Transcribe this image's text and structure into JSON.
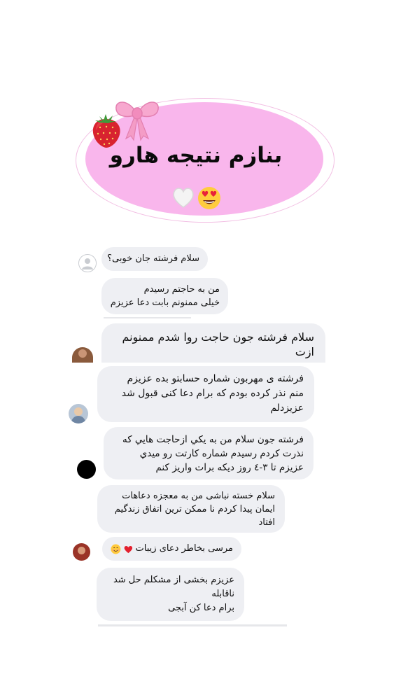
{
  "header": {
    "title": "بنازم نتیجه هارو"
  },
  "messages": [
    {
      "lines": [
        "سلام فرشته جان خوبی؟"
      ]
    },
    {
      "lines": [
        "من به حاجتم رسیدم",
        "خیلی ممنونم بابت دعا عزیزم"
      ]
    },
    {
      "lines": [
        "سلام فرشته جون حاجت روا شدم ممنونم",
        "ازت"
      ]
    },
    {
      "lines": [
        "فرشته ی مهربون شماره حسابتو بده عزیزم",
        "منم نذر کرده بودم که برام دعا کنی قبول شد",
        "عزیزدلم"
      ]
    },
    {
      "lines": [
        "فرشته جون سلام من به يكي ازحاجت هايي كه",
        "نذرت كردم رسيدم شماره كارتت رو ميدي",
        "عزيزم تا ٣-٤ روز ديكه برات واريز كنم"
      ]
    },
    {
      "lines": [
        "سلام خسته نباشی من به معجزه دعاهات",
        "ایمان پیدا کردم نا ممکن ترین اتفاق زندگیم",
        "افتاد"
      ]
    },
    {
      "lines": [
        "مرسی بخاطر دعای زیبات"
      ]
    },
    {
      "lines": [
        "عزیزم بخشی از مشکلم حل شد",
        "ناقابله",
        "برام دعا کن آبجی"
      ]
    }
  ]
}
